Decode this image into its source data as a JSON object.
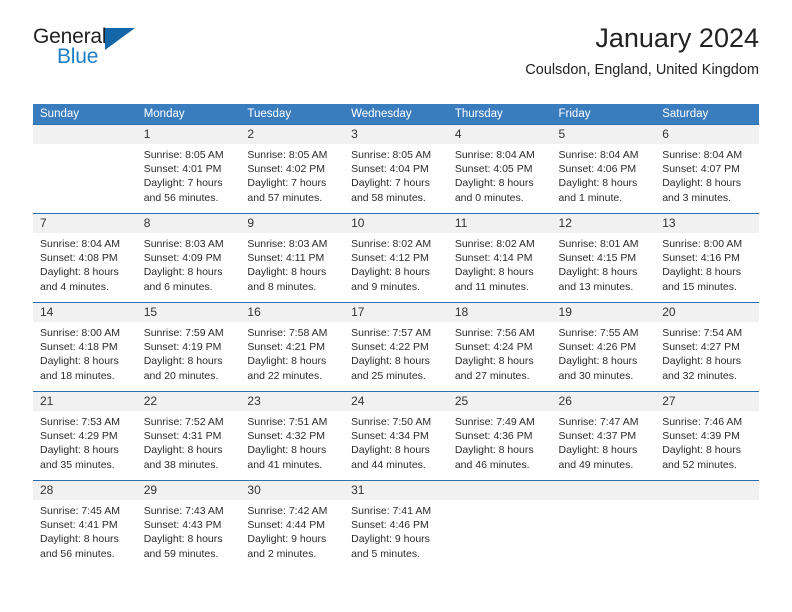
{
  "brand": {
    "name_top": "General",
    "name_bottom": "Blue",
    "triangle_color": "#1466a8",
    "blue_color": "#1f7fc4"
  },
  "header": {
    "title": "January 2024",
    "location": "Coulsdon, England, United Kingdom",
    "header_bg": "#3a7dbf",
    "daynum_bg": "#f1f1f1"
  },
  "weekdays": [
    "Sunday",
    "Monday",
    "Tuesday",
    "Wednesday",
    "Thursday",
    "Friday",
    "Saturday"
  ],
  "weeks": [
    [
      {
        "day": "",
        "sunrise": "",
        "sunset": "",
        "daylight1": "",
        "daylight2": ""
      },
      {
        "day": "1",
        "sunrise": "Sunrise: 8:05 AM",
        "sunset": "Sunset: 4:01 PM",
        "daylight1": "Daylight: 7 hours",
        "daylight2": "and 56 minutes."
      },
      {
        "day": "2",
        "sunrise": "Sunrise: 8:05 AM",
        "sunset": "Sunset: 4:02 PM",
        "daylight1": "Daylight: 7 hours",
        "daylight2": "and 57 minutes."
      },
      {
        "day": "3",
        "sunrise": "Sunrise: 8:05 AM",
        "sunset": "Sunset: 4:04 PM",
        "daylight1": "Daylight: 7 hours",
        "daylight2": "and 58 minutes."
      },
      {
        "day": "4",
        "sunrise": "Sunrise: 8:04 AM",
        "sunset": "Sunset: 4:05 PM",
        "daylight1": "Daylight: 8 hours",
        "daylight2": "and 0 minutes."
      },
      {
        "day": "5",
        "sunrise": "Sunrise: 8:04 AM",
        "sunset": "Sunset: 4:06 PM",
        "daylight1": "Daylight: 8 hours",
        "daylight2": "and 1 minute."
      },
      {
        "day": "6",
        "sunrise": "Sunrise: 8:04 AM",
        "sunset": "Sunset: 4:07 PM",
        "daylight1": "Daylight: 8 hours",
        "daylight2": "and 3 minutes."
      }
    ],
    [
      {
        "day": "7",
        "sunrise": "Sunrise: 8:04 AM",
        "sunset": "Sunset: 4:08 PM",
        "daylight1": "Daylight: 8 hours",
        "daylight2": "and 4 minutes."
      },
      {
        "day": "8",
        "sunrise": "Sunrise: 8:03 AM",
        "sunset": "Sunset: 4:09 PM",
        "daylight1": "Daylight: 8 hours",
        "daylight2": "and 6 minutes."
      },
      {
        "day": "9",
        "sunrise": "Sunrise: 8:03 AM",
        "sunset": "Sunset: 4:11 PM",
        "daylight1": "Daylight: 8 hours",
        "daylight2": "and 8 minutes."
      },
      {
        "day": "10",
        "sunrise": "Sunrise: 8:02 AM",
        "sunset": "Sunset: 4:12 PM",
        "daylight1": "Daylight: 8 hours",
        "daylight2": "and 9 minutes."
      },
      {
        "day": "11",
        "sunrise": "Sunrise: 8:02 AM",
        "sunset": "Sunset: 4:14 PM",
        "daylight1": "Daylight: 8 hours",
        "daylight2": "and 11 minutes."
      },
      {
        "day": "12",
        "sunrise": "Sunrise: 8:01 AM",
        "sunset": "Sunset: 4:15 PM",
        "daylight1": "Daylight: 8 hours",
        "daylight2": "and 13 minutes."
      },
      {
        "day": "13",
        "sunrise": "Sunrise: 8:00 AM",
        "sunset": "Sunset: 4:16 PM",
        "daylight1": "Daylight: 8 hours",
        "daylight2": "and 15 minutes."
      }
    ],
    [
      {
        "day": "14",
        "sunrise": "Sunrise: 8:00 AM",
        "sunset": "Sunset: 4:18 PM",
        "daylight1": "Daylight: 8 hours",
        "daylight2": "and 18 minutes."
      },
      {
        "day": "15",
        "sunrise": "Sunrise: 7:59 AM",
        "sunset": "Sunset: 4:19 PM",
        "daylight1": "Daylight: 8 hours",
        "daylight2": "and 20 minutes."
      },
      {
        "day": "16",
        "sunrise": "Sunrise: 7:58 AM",
        "sunset": "Sunset: 4:21 PM",
        "daylight1": "Daylight: 8 hours",
        "daylight2": "and 22 minutes."
      },
      {
        "day": "17",
        "sunrise": "Sunrise: 7:57 AM",
        "sunset": "Sunset: 4:22 PM",
        "daylight1": "Daylight: 8 hours",
        "daylight2": "and 25 minutes."
      },
      {
        "day": "18",
        "sunrise": "Sunrise: 7:56 AM",
        "sunset": "Sunset: 4:24 PM",
        "daylight1": "Daylight: 8 hours",
        "daylight2": "and 27 minutes."
      },
      {
        "day": "19",
        "sunrise": "Sunrise: 7:55 AM",
        "sunset": "Sunset: 4:26 PM",
        "daylight1": "Daylight: 8 hours",
        "daylight2": "and 30 minutes."
      },
      {
        "day": "20",
        "sunrise": "Sunrise: 7:54 AM",
        "sunset": "Sunset: 4:27 PM",
        "daylight1": "Daylight: 8 hours",
        "daylight2": "and 32 minutes."
      }
    ],
    [
      {
        "day": "21",
        "sunrise": "Sunrise: 7:53 AM",
        "sunset": "Sunset: 4:29 PM",
        "daylight1": "Daylight: 8 hours",
        "daylight2": "and 35 minutes."
      },
      {
        "day": "22",
        "sunrise": "Sunrise: 7:52 AM",
        "sunset": "Sunset: 4:31 PM",
        "daylight1": "Daylight: 8 hours",
        "daylight2": "and 38 minutes."
      },
      {
        "day": "23",
        "sunrise": "Sunrise: 7:51 AM",
        "sunset": "Sunset: 4:32 PM",
        "daylight1": "Daylight: 8 hours",
        "daylight2": "and 41 minutes."
      },
      {
        "day": "24",
        "sunrise": "Sunrise: 7:50 AM",
        "sunset": "Sunset: 4:34 PM",
        "daylight1": "Daylight: 8 hours",
        "daylight2": "and 44 minutes."
      },
      {
        "day": "25",
        "sunrise": "Sunrise: 7:49 AM",
        "sunset": "Sunset: 4:36 PM",
        "daylight1": "Daylight: 8 hours",
        "daylight2": "and 46 minutes."
      },
      {
        "day": "26",
        "sunrise": "Sunrise: 7:47 AM",
        "sunset": "Sunset: 4:37 PM",
        "daylight1": "Daylight: 8 hours",
        "daylight2": "and 49 minutes."
      },
      {
        "day": "27",
        "sunrise": "Sunrise: 7:46 AM",
        "sunset": "Sunset: 4:39 PM",
        "daylight1": "Daylight: 8 hours",
        "daylight2": "and 52 minutes."
      }
    ],
    [
      {
        "day": "28",
        "sunrise": "Sunrise: 7:45 AM",
        "sunset": "Sunset: 4:41 PM",
        "daylight1": "Daylight: 8 hours",
        "daylight2": "and 56 minutes."
      },
      {
        "day": "29",
        "sunrise": "Sunrise: 7:43 AM",
        "sunset": "Sunset: 4:43 PM",
        "daylight1": "Daylight: 8 hours",
        "daylight2": "and 59 minutes."
      },
      {
        "day": "30",
        "sunrise": "Sunrise: 7:42 AM",
        "sunset": "Sunset: 4:44 PM",
        "daylight1": "Daylight: 9 hours",
        "daylight2": "and 2 minutes."
      },
      {
        "day": "31",
        "sunrise": "Sunrise: 7:41 AM",
        "sunset": "Sunset: 4:46 PM",
        "daylight1": "Daylight: 9 hours",
        "daylight2": "and 5 minutes."
      },
      {
        "day": "",
        "sunrise": "",
        "sunset": "",
        "daylight1": "",
        "daylight2": ""
      },
      {
        "day": "",
        "sunrise": "",
        "sunset": "",
        "daylight1": "",
        "daylight2": ""
      },
      {
        "day": "",
        "sunrise": "",
        "sunset": "",
        "daylight1": "",
        "daylight2": ""
      }
    ]
  ]
}
